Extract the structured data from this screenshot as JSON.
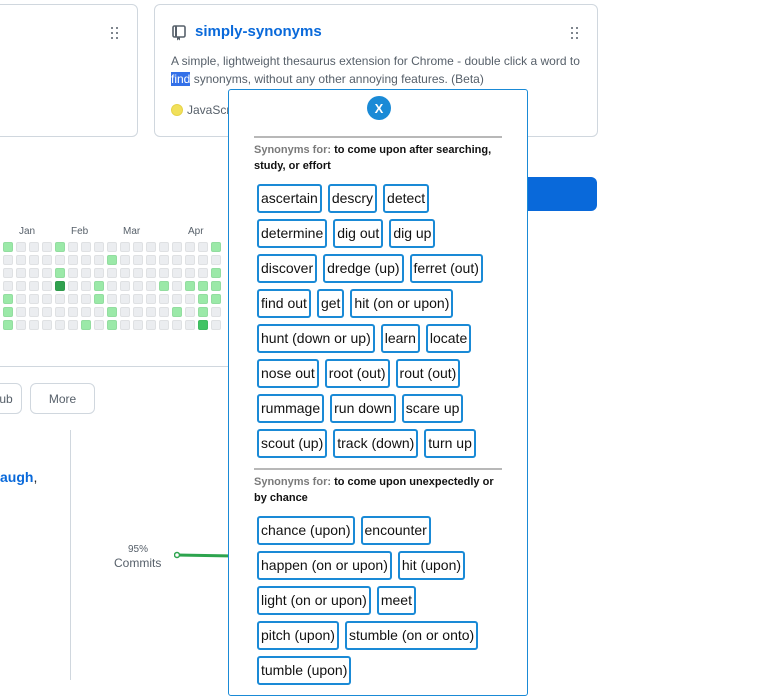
{
  "card": {
    "repo_name": "simply-synonyms",
    "description_before": "A simple, lightweight thesaurus extension for Chrome - double click a word to ",
    "description_highlight": "find",
    "description_after": " synonyms, without any other annoying features. (Beta)",
    "language": "JavaScri",
    "language_color": "#f1e05a"
  },
  "contributions": {
    "months": [
      "Jan",
      "Feb",
      "Mar",
      "Apr"
    ]
  },
  "buttons": {
    "hub_label": "ub",
    "more_label": "More"
  },
  "activity": {
    "user_link": "augh",
    "user_link_suffix": ",",
    "percent": "95%",
    "label": "Commits"
  },
  "popup": {
    "close_label": "X",
    "sections": [
      {
        "label": "Synonyms for:",
        "definition": "to come upon after searching, study, or effort",
        "words": [
          "ascertain",
          "descry",
          "detect",
          "determine",
          "dig out",
          "dig up",
          "discover",
          "dredge (up)",
          "ferret (out)",
          "find out",
          "get",
          "hit (on or upon)",
          "hunt (down or up)",
          "learn",
          "locate",
          "nose out",
          "root (out)",
          "rout (out)",
          "rummage",
          "run down",
          "scare up",
          "scout (up)",
          "track (down)",
          "turn up"
        ]
      },
      {
        "label": "Synonyms for:",
        "definition": "to come upon unexpectedly or by chance",
        "words": [
          "chance (upon)",
          "encounter",
          "happen (on or upon)",
          "hit (upon)",
          "light (on or upon)",
          "meet",
          "pitch (upon)",
          "stumble (on or onto)",
          "tumble (upon)"
        ]
      }
    ]
  },
  "colors": {
    "accent": "#1a8ad6",
    "link": "#0969da"
  }
}
